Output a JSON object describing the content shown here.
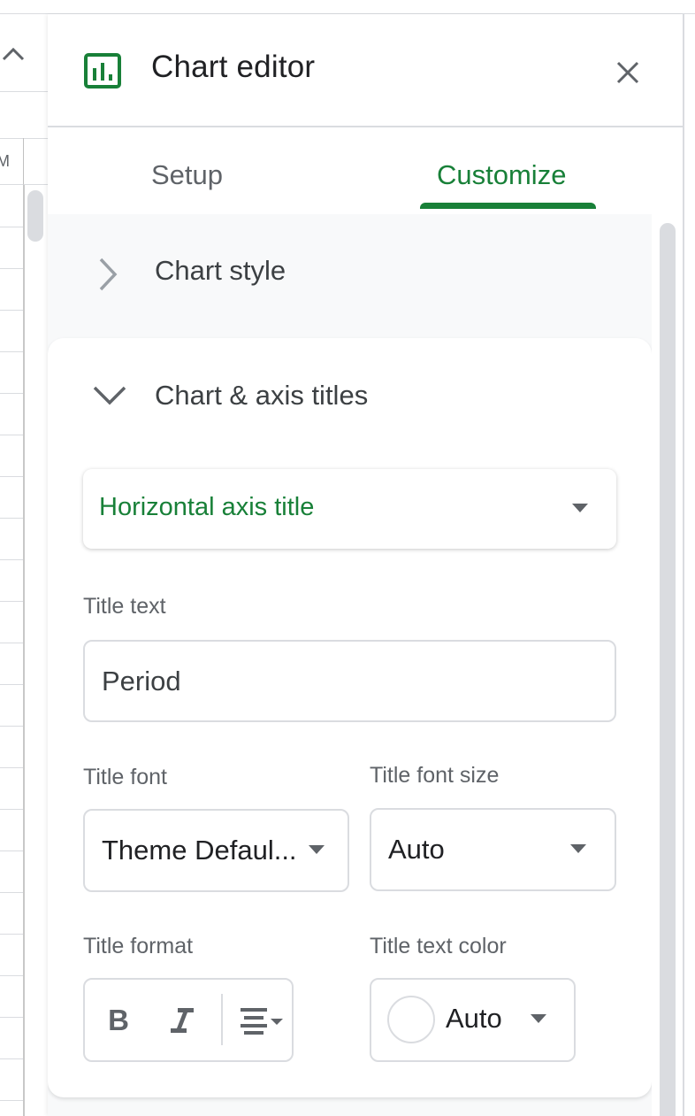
{
  "sheet": {
    "column_label": "M",
    "collapse_icon": "chevron-up-icon"
  },
  "editor": {
    "title": "Chart editor",
    "icon": "bar-chart-icon",
    "close_icon": "close-icon",
    "accent_color": "#188038"
  },
  "tabs": [
    {
      "label": "Setup",
      "active": false
    },
    {
      "label": "Customize",
      "active": true
    }
  ],
  "sections": {
    "chart_style": {
      "label": "Chart style",
      "expanded": false
    },
    "chart_axis_titles": {
      "label": "Chart & axis titles",
      "expanded": true,
      "target_picker": {
        "value": "Horizontal axis title"
      },
      "title_text": {
        "label": "Title text",
        "value": "Period"
      },
      "title_font": {
        "label": "Title font",
        "value": "Theme Defaul..."
      },
      "title_font_size": {
        "label": "Title font size",
        "value": "Auto"
      },
      "title_format": {
        "label": "Title format",
        "bold": {
          "glyph": "B",
          "icon": "bold-icon"
        },
        "italic": {
          "glyph": "I",
          "icon": "italic-icon"
        },
        "align": {
          "icon": "align-dropdown-icon"
        }
      },
      "title_text_color": {
        "label": "Title text color",
        "value": "Auto",
        "swatch": "#ffffff"
      }
    }
  }
}
